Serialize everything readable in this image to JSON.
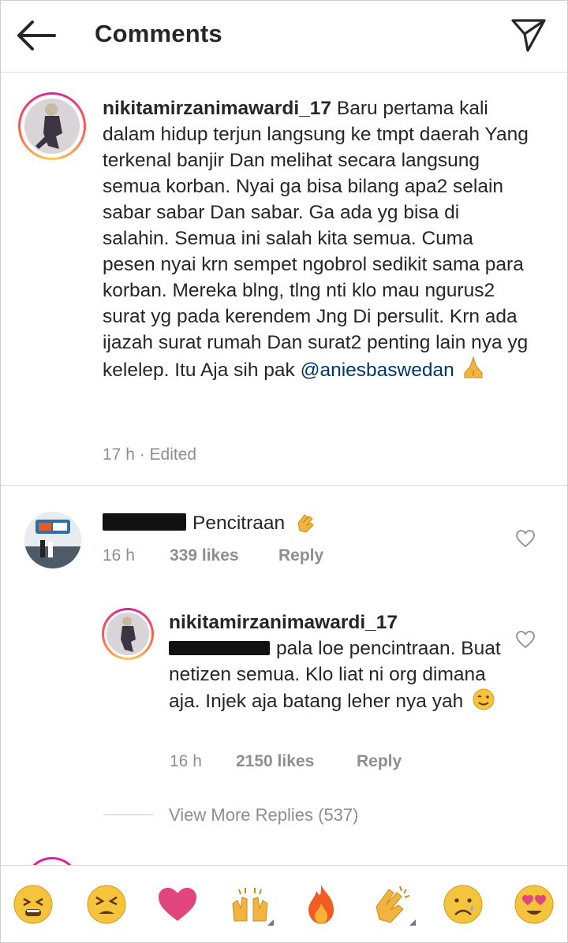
{
  "header": {
    "title": "Comments"
  },
  "caption": {
    "username": "nikitamirzanimawardi_17",
    "text": "Baru pertama kali dalam hidup terjun langsung ke tmpt daerah Yang terkenal banjir Dan melihat secara langsung semua korban. Nyai ga bisa bilang apa2 selain sabar sabar Dan sabar. Ga ada yg bisa di salahin. Semua ini salah kita semua. Cuma pesen nyai krn sempet ngobrol sedikit sama para korban. Mereka blng, tlng nti klo mau ngurus2 surat yg pada kerendem Jng Di persulit. Krn ada ijazah surat rumah Dan surat2 penting lain nya yg kelelep. Itu Aja sih pak",
    "mention": "@aniesbaswedan",
    "time": "17 h · Edited"
  },
  "comment1": {
    "text": "Pencitraan",
    "time": "16 h",
    "likes": "339 likes",
    "reply": "Reply"
  },
  "reply1": {
    "username": "nikitamirzanimawardi_17",
    "text": "pala loe pencintraan. Buat netizen semua. Klo liat ni org dimana aja. Injek aja batang leher nya yah",
    "time": "16 h",
    "likes": "2150 likes",
    "reply": "Reply"
  },
  "view_more": "View More Replies (537)",
  "icons": {
    "back": "back-arrow-icon",
    "send": "send-icon",
    "like": "heart-outline-icon"
  },
  "emoji_bar": [
    "persevering-face",
    "tired-face",
    "heart",
    "raising-hands",
    "fire",
    "clapping-hands",
    "frowning-face",
    "heart-eyes-face"
  ]
}
